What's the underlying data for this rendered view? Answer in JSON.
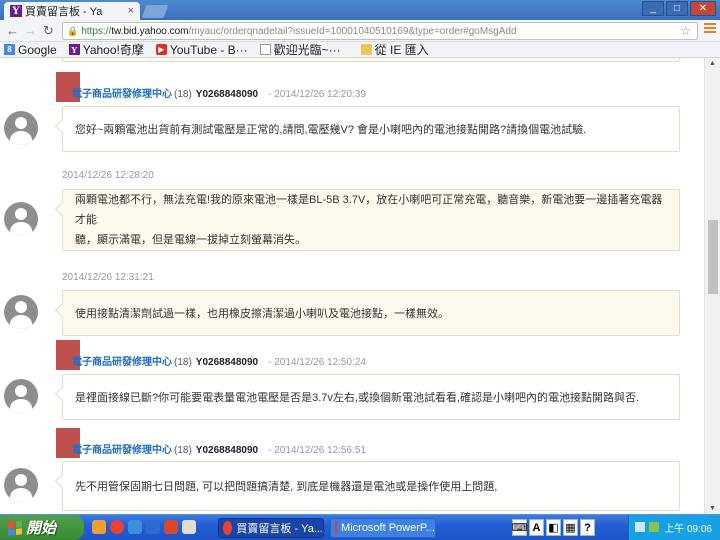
{
  "browser": {
    "tab_title": "買賣留言板 - Ya",
    "tab_favicon": "Y",
    "tab_close": "×",
    "url_https": "https://",
    "url_host": "tw.bid.yahoo.com",
    "url_path": "/myauc/orderqnadetail?issueId=10001040510169&type=order#goMsgAdd",
    "bookmarks": [
      {
        "label": "Google",
        "icon": "google-icon"
      },
      {
        "label": "Yahoo!奇摩",
        "icon": "yahoo-icon"
      },
      {
        "label": "YouTube - B···",
        "icon": "youtube-icon"
      },
      {
        "label": "歡迎光臨~···",
        "icon": "page-icon"
      },
      {
        "label": "從 IE 匯入",
        "icon": "folder-icon"
      }
    ]
  },
  "messages": [
    {
      "role": "seller",
      "name": "電子商品研發修理中心",
      "count": "(18)",
      "uid": "Y0268848090",
      "timestamp": "- 2014/12/26 12:20:39",
      "text": "您好~兩顆電池出貨前有測試電壓是正常的,請問,電壓幾V? 會是小喇吧內的電池接點開路?請換個電池試驗."
    },
    {
      "role": "buyer",
      "timestamp": "2014/12/26 12:28:20",
      "text1": "兩顆電池都不行，無法充電!我的原來電池一樣是BL-5B 3.7V，放在小喇吧可正常充電，聽音樂，新電池要一邊插著充電器才能",
      "text2": "聽，顯示滿電，但是電線一拔掉立刻螢幕消失。"
    },
    {
      "role": "buyer",
      "timestamp": "2014/12/26 12:31:21",
      "text": "使用接點清潔劑試過一樣，也用橡皮擦清潔過小喇叭及電池接點，一樣無效。"
    },
    {
      "role": "seller",
      "name": "電子商品研發修理中心",
      "count": "(18)",
      "uid": "Y0268848090",
      "timestamp": "- 2014/12/26 12:50:24",
      "text": "是裡面接線已斷?你可能要電表量電池電壓是否是3.7v左右,或換個新電池試看看,確認是小喇吧內的電池接點開路與否."
    },
    {
      "role": "seller",
      "name": "電子商品研發修理中心",
      "count": "(18)",
      "uid": "Y0268848090",
      "timestamp": "- 2014/12/26 12:56:51",
      "text": "先不用管保固期七日問題, 可以把問題搞清楚, 到底是機器還是電池或是操作使用上問題,"
    }
  ],
  "taskbar": {
    "start_label": "開始",
    "task1": "買賣留言板 - Ya...",
    "task2": "Microsoft PowerP...",
    "lang_a": "A",
    "clock": "上午 09:06"
  }
}
